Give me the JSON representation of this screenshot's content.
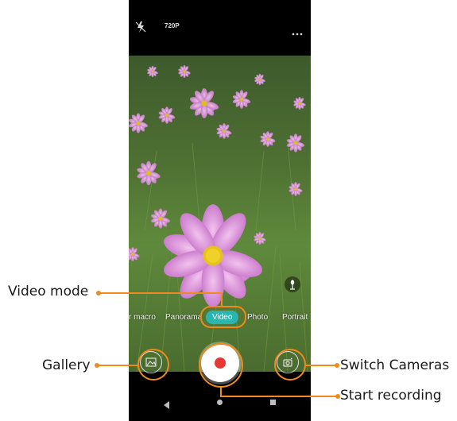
{
  "callouts": {
    "video_mode": "Video mode",
    "gallery": "Gallery",
    "switch_cameras": "Switch Cameras",
    "start_recording": "Start recording"
  },
  "topbar": {
    "resolution": "720P",
    "flash_icon": "flash-off-icon",
    "more_icon": "more-dots-icon"
  },
  "modes": [
    "r macro",
    "Panorama",
    "Video",
    "Photo",
    "Portrait"
  ],
  "active_mode": "Video",
  "icons": {
    "gallery": "gallery-icon",
    "shutter": "record-icon",
    "switch": "switch-camera-icon",
    "scene": "scene-detect-icon",
    "nav_back": "nav-back-icon",
    "nav_home": "nav-home-icon",
    "nav_recents": "nav-recents-icon"
  },
  "colors": {
    "accent": "#f08a1e",
    "active_mode": "#2bb5b1",
    "record": "#e53935"
  }
}
